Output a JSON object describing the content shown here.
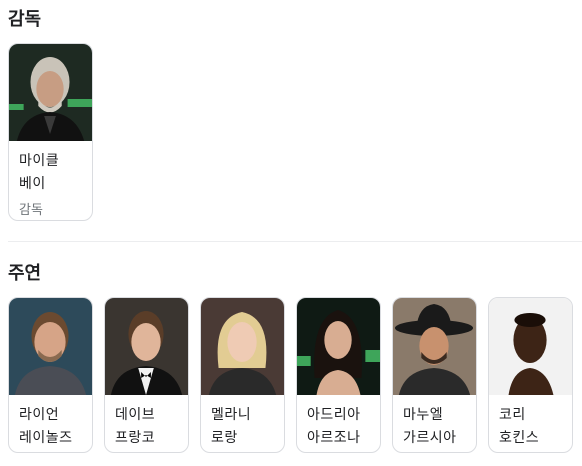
{
  "sections": {
    "director_title": "감독",
    "cast_title": "주연"
  },
  "director": {
    "name": "마이클 베이",
    "role": "감독"
  },
  "cast": [
    {
      "name": "라이언 레이놀즈"
    },
    {
      "name": "데이브 프랑코"
    },
    {
      "name": "멜라니 로랑"
    },
    {
      "name": "아드리아 아르조나"
    },
    {
      "name": "마누엘 가르시아 …"
    },
    {
      "name": "코리 호킨스"
    }
  ],
  "colors": {
    "card_border": "#dadce0",
    "text": "#202124",
    "secondary_text": "#70757a"
  }
}
